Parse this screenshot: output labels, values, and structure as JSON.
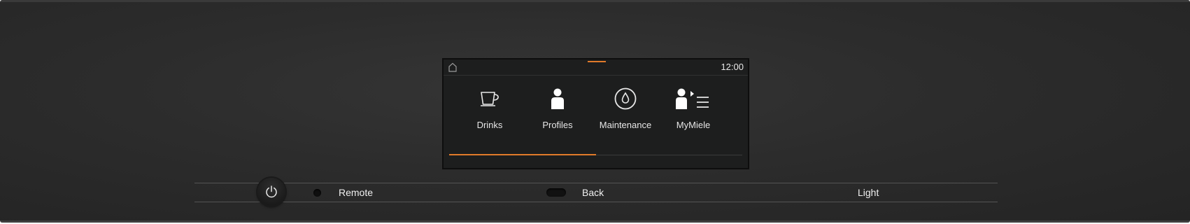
{
  "display": {
    "clock": "12:00",
    "menu_items": [
      {
        "label": "Drinks",
        "icon": "cup-icon"
      },
      {
        "label": "Profiles",
        "icon": "person-icon"
      },
      {
        "label": "Maintenance",
        "icon": "drop-icon"
      },
      {
        "label": "MyMiele",
        "icon": "person-list-icon"
      }
    ],
    "page_position": 0.5
  },
  "controls": {
    "remote_label": "Remote",
    "back_label": "Back",
    "light_label": "Light"
  },
  "colors": {
    "accent": "#e07a2a",
    "panel": "#2c2c2c",
    "screen": "#1d1e1e"
  }
}
